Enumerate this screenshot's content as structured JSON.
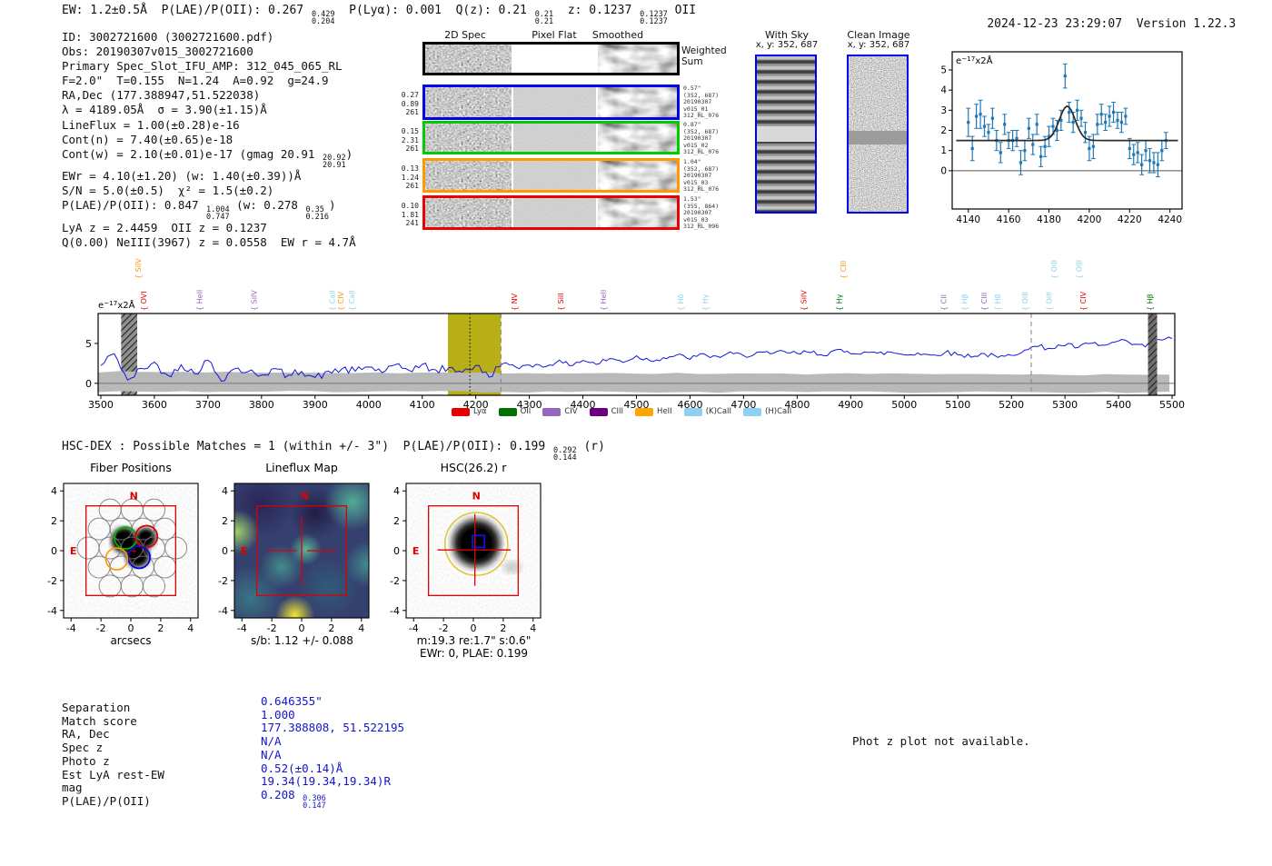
{
  "header": {
    "left_tokens": [
      {
        "t": "EW: 1.2±0.5Å  P(LAE)/P(OII): 0.267 "
      },
      {
        "s": [
          "0.429",
          "0.204"
        ]
      },
      {
        "t": "  P(Lyα): 0.001  Q(z): 0.21 "
      },
      {
        "s": [
          "0.21",
          "0.21"
        ]
      },
      {
        "t": "  z: 0.1237 "
      },
      {
        "s": [
          "0.1237",
          "0.1237"
        ]
      },
      {
        "t": " OII"
      }
    ],
    "timestamp": "2024-12-23 23:29:07",
    "version": "Version 1.22.3"
  },
  "info_lines": [
    [
      {
        "t": "ID: 3002721600 (3002721600.pdf)"
      }
    ],
    [
      {
        "t": "Obs: 20190307v015_3002721600"
      }
    ],
    [
      {
        "t": "Primary Spec_Slot_IFU_AMP: 312_045_065_RL"
      }
    ],
    [
      {
        "t": "F=2.0\"  T=0.155  N=1.24  A=0.92  g=24.9"
      }
    ],
    [
      {
        "t": "RA,Dec (177.388947,51.522038)"
      }
    ],
    [
      {
        "t": "λ = 4189.05Å  σ = 3.90(±1.15)Å"
      }
    ],
    [
      {
        "t": "LineFlux = 1.00(±0.28)e-16"
      }
    ],
    [
      {
        "t": "Cont(n) = 7.40(±0.65)e-18"
      }
    ],
    [
      {
        "t": "Cont(w) = 2.10(±0.01)e-17 (gmag 20.91 "
      },
      {
        "s": [
          "20.92",
          "20.91"
        ]
      },
      {
        "t": ")"
      }
    ],
    [
      {
        "t": "EWr = 4.10(±1.20) (w: 1.40(±0.39))Å"
      }
    ],
    [
      {
        "t": "S/N = 5.0(±0.5)  χ² = 1.5(±0.2)"
      }
    ],
    [
      {
        "t": "P(LAE)/P(OII): 0.847 "
      },
      {
        "s": [
          "1.004",
          "0.747"
        ]
      },
      {
        "t": " (w: 0.278 "
      },
      {
        "s": [
          "0.35",
          "0.216"
        ]
      },
      {
        "t": ")"
      }
    ],
    [
      {
        "t": "LyA z = 2.4459  OII z = 0.1237"
      }
    ],
    [
      {
        "t": "Q(0.00) NeIII(3967) z = 0.0558  EW r = 4.7Å"
      }
    ]
  ],
  "spec2d": {
    "headers": [
      "2D Spec",
      "Pixel Flat",
      "Smoothed"
    ],
    "weighted_sum_label": "Weighted\nSum",
    "rows": [
      {
        "border": "#000000",
        "left": [],
        "right": []
      },
      {
        "border": "#0000ee",
        "left": [
          "0.27",
          "0.89",
          "261"
        ],
        "right": [
          "0.57\"",
          "(352, 687)",
          "20190307",
          "v015_01",
          "312_RL_076"
        ]
      },
      {
        "border": "#00cc00",
        "left": [
          "0.15",
          "2.31",
          "261"
        ],
        "right": [
          "0.87\"",
          "(352, 687)",
          "20190307",
          "v015_02",
          "312_RL_076"
        ]
      },
      {
        "border": "#ff9900",
        "left": [
          "0.13",
          "1.24",
          "261"
        ],
        "right": [
          "1.04\"",
          "(352, 687)",
          "20190307",
          "v015_03",
          "312_RL_076"
        ]
      },
      {
        "border": "#ee0000",
        "left": [
          "0.10",
          "1.81",
          "241"
        ],
        "right": [
          "1.53\"",
          "(355, 864)",
          "20190307",
          "v015_03",
          "312_RL_096"
        ]
      }
    ]
  },
  "cutouts2d": {
    "with_sky": {
      "title": "With Sky",
      "coords": "x, y: 352, 687"
    },
    "clean": {
      "title": "Clean Image",
      "coords": "x, y: 352, 687"
    }
  },
  "hsc_line_tokens": [
    {
      "t": "HSC-DEX : Possible Matches = 1 (within +/- 3\")  P(LAE)/P(OII): 0.199 "
    },
    {
      "s": [
        "0.292",
        "0.144"
      ]
    },
    {
      "t": " (r)"
    }
  ],
  "phot_z_note": "Phot z plot not available.",
  "match_table": {
    "rows": [
      {
        "label": "Separation",
        "value_tokens": [
          {
            "t": "0.646355\""
          }
        ]
      },
      {
        "label": "Match score",
        "value_tokens": [
          {
            "t": "1.000"
          }
        ]
      },
      {
        "label": "RA, Dec",
        "value_tokens": [
          {
            "t": "177.388808, 51.522195"
          }
        ]
      },
      {
        "label": "Spec z",
        "value_tokens": [
          {
            "t": "N/A"
          }
        ]
      },
      {
        "label": "Photo z",
        "value_tokens": [
          {
            "t": "N/A"
          }
        ]
      },
      {
        "label": "Est LyA rest-EW",
        "value_tokens": [
          {
            "t": "0.52(±0.14)Å"
          }
        ]
      },
      {
        "label": "mag",
        "value_tokens": [
          {
            "t": "19.34(19.34,19.34)R"
          }
        ]
      },
      {
        "label": "P(LAE)/P(OII)",
        "value_tokens": [
          {
            "t": "0.208 "
          },
          {
            "s": [
              "0.306",
              "0.147"
            ]
          }
        ]
      }
    ]
  },
  "chart_data": [
    {
      "id": "line_fit_zoom",
      "type": "scatter",
      "inner_label": "e-17x2Å",
      "xlim": [
        4132,
        4246
      ],
      "ylim": [
        -1.9,
        5.9
      ],
      "xticks": [
        4140,
        4160,
        4180,
        4200,
        4220,
        4240
      ],
      "yticks": [
        0,
        1,
        2,
        3,
        4,
        5
      ],
      "x_start": 4140,
      "x_step": 2,
      "y": [
        2.4,
        1.1,
        2.7,
        2.8,
        2.2,
        1.9,
        2.6,
        1.5,
        0.9,
        2.3,
        1.5,
        1.5,
        1.6,
        0.4,
        1.0,
        2.1,
        1.3,
        2.3,
        0.7,
        1.2,
        1.7,
        2.2,
        2.0,
        2.5,
        4.7,
        2.9,
        2.4,
        3.0,
        2.6,
        1.9,
        1.1,
        1.2,
        2.3,
        2.8,
        2.4,
        2.7,
        2.9,
        2.5,
        2.4,
        2.7,
        1.1,
        0.8,
        0.9,
        0.3,
        1.0,
        0.5,
        0.4,
        0.3,
        1.0,
        1.5
      ],
      "yerr": [
        0.7,
        0.6,
        0.6,
        0.7,
        0.5,
        0.4,
        0.5,
        0.5,
        0.5,
        0.5,
        0.4,
        0.5,
        0.4,
        0.6,
        0.5,
        0.5,
        0.5,
        0.5,
        0.5,
        0.5,
        0.5,
        0.4,
        0.5,
        0.5,
        0.6,
        0.5,
        0.5,
        0.5,
        0.4,
        0.5,
        0.6,
        0.6,
        0.5,
        0.5,
        0.4,
        0.5,
        0.5,
        0.4,
        0.5,
        0.4,
        0.5,
        0.5,
        0.5,
        0.5,
        0.5,
        0.6,
        0.5,
        0.6,
        0.5,
        0.4
      ],
      "fit": {
        "shape": "gaussian",
        "center": 4189.05,
        "sigma": 3.9,
        "peak": 3.2,
        "continuum": 1.5
      },
      "colors": {
        "points": "#1f77b4",
        "fit": "#2b2b2b",
        "zero_line": "#555555"
      }
    },
    {
      "id": "full_spectrum",
      "type": "line",
      "ylabel": "e-17x2Å",
      "x_start": 3500,
      "x_step": 25,
      "values": [
        2.2,
        3.8,
        0.3,
        1.8,
        2.6,
        0.9,
        2.4,
        1.2,
        2.9,
        0.4,
        1.9,
        1.4,
        1.1,
        1.8,
        0.9,
        1.6,
        0.7,
        1.4,
        1.8,
        1.5,
        2.1,
        1.4,
        2.2,
        1.7,
        2.3,
        1.6,
        1.9,
        1.5,
        2.2,
        0.8,
        2.6,
        1.9,
        2.4,
        2.1,
        2.7,
        2.3,
        2.9,
        2.4,
        3.1,
        2.7,
        3.4,
        2.9,
        3.2,
        3.5,
        3.1,
        3.6,
        3.3,
        3.8,
        3.4,
        3.9,
        3.6,
        4.0,
        3.7,
        3.9,
        3.6,
        4.1,
        3.8,
        4.0,
        3.7,
        3.9,
        3.6,
        3.8,
        3.5,
        3.9,
        3.6,
        3.4,
        3.7,
        3.2,
        3.5,
        4.3,
        4.6,
        4.4,
        4.8,
        4.5,
        5.0,
        4.7,
        5.3,
        4.9,
        4.6,
        5.5,
        5.6
      ],
      "xlim": [
        3495,
        5505
      ],
      "ylim": [
        -1.5,
        8.75
      ],
      "xticks": [
        3500,
        3600,
        3700,
        3800,
        3900,
        4000,
        4100,
        4200,
        4300,
        4400,
        4500,
        4600,
        4700,
        4800,
        4900,
        5000,
        5100,
        5200,
        5300,
        5400,
        5500
      ],
      "yticks": [
        0,
        5
      ],
      "colors": {
        "line": "#1414dd",
        "noise_band": "#b9b9b9",
        "highlight": "#b3ab08",
        "sky_band": "#8f8f8f",
        "dashed": "#888888"
      },
      "annotations": {
        "emission_center": 4189.05,
        "highlight_region": [
          4148,
          4247
        ],
        "sky_absorption_band": [
          3538,
          3568
        ],
        "dashed_lines": [
          4247,
          5237
        ],
        "hatch_band": [
          5455,
          5472
        ]
      },
      "line_labels": [
        {
          "text": "SiIV",
          "color": "#ff9900",
          "wl": 3570,
          "tier": 1
        },
        {
          "text": "OVI",
          "color": "#e50000",
          "wl": 3580,
          "tier": 0
        },
        {
          "text": "HeII",
          "color": "#9467bd",
          "wl": 3684,
          "tier": 0
        },
        {
          "text": "SiIV",
          "color": "#9467bd",
          "wl": 3786,
          "tier": 0
        },
        {
          "text": "CaII",
          "color": "#8fd0f0",
          "wl": 3932,
          "tier": 0
        },
        {
          "text": "CIV",
          "color": "#ff9900",
          "wl": 3948,
          "tier": 0
        },
        {
          "text": "CaII",
          "color": "#8fd0f0",
          "wl": 3968,
          "tier": 0
        },
        {
          "text": "NV",
          "color": "#e50000",
          "wl": 4272,
          "tier": 0
        },
        {
          "text": "SiII",
          "color": "#e50000",
          "wl": 4358,
          "tier": 0
        },
        {
          "text": "HeII",
          "color": "#9467bd",
          "wl": 4438,
          "tier": 0
        },
        {
          "text": "Hδ",
          "color": "#8fd0f0",
          "wl": 4582,
          "tier": 0
        },
        {
          "text": "Hγ",
          "color": "#8fd0f0",
          "wl": 4628,
          "tier": 0
        },
        {
          "text": "SiIV",
          "color": "#e50000",
          "wl": 4812,
          "tier": 0
        },
        {
          "text": "CIII",
          "color": "#ff9900",
          "wl": 4886,
          "tier": 1
        },
        {
          "text": "Hγ",
          "color": "#007000",
          "wl": 4878,
          "tier": 0
        },
        {
          "text": "CII",
          "color": "#9467bd",
          "wl": 5073,
          "tier": 0
        },
        {
          "text": "Hβ",
          "color": "#8fd0f0",
          "wl": 5112,
          "tier": 0
        },
        {
          "text": "CIII",
          "color": "#9467bd",
          "wl": 5149,
          "tier": 0
        },
        {
          "text": "H8",
          "color": "#8fd0f0",
          "wl": 5174,
          "tier": 0
        },
        {
          "text": "OIII",
          "color": "#8fd0f0",
          "wl": 5225,
          "tier": 0
        },
        {
          "text": "OIII",
          "color": "#8fd0f0",
          "wl": 5270,
          "tier": 0
        },
        {
          "text": "OIII",
          "color": "#8fd0f0",
          "wl": 5279,
          "tier": 1
        },
        {
          "text": "OIII",
          "color": "#8fd0f0",
          "wl": 5326,
          "tier": 1
        },
        {
          "text": "CIV",
          "color": "#e50000",
          "wl": 5334,
          "tier": 0
        },
        {
          "text": "Hβ",
          "color": "#007000",
          "wl": 5458,
          "tier": 0
        }
      ],
      "legend": [
        {
          "label": "Lyα",
          "color": "#e50000"
        },
        {
          "label": "OII",
          "color": "#007000"
        },
        {
          "label": "CIV",
          "color": "#9467bd"
        },
        {
          "label": "CIII",
          "color": "#6a0080"
        },
        {
          "label": "HeII",
          "color": "#ffa500"
        },
        {
          "label": "(K)CaII",
          "color": "#8fd0f0"
        },
        {
          "label": "(H)CaII",
          "color": "#8fd0f0"
        }
      ]
    },
    {
      "id": "fiber_positions",
      "type": "scatter",
      "title": "Fiber Positions",
      "xlabel": "arcsecs",
      "ticks": [
        -4,
        -2,
        0,
        2,
        4
      ],
      "lim": [
        -4.5,
        4.5
      ],
      "fiber_radius_arcsec": 0.73,
      "grid_center": [
        0.08,
        0.18
      ],
      "grid_spacing": 1.47,
      "highlight_fibers": [
        {
          "x": -0.35,
          "y": 0.85,
          "color": "#00b300"
        },
        {
          "x": 1.05,
          "y": 0.95,
          "color": "#dd0000"
        },
        {
          "x": 0.55,
          "y": -0.45,
          "color": "#0000dd"
        },
        {
          "x": -0.95,
          "y": -0.55,
          "color": "#ff9900"
        }
      ],
      "compass": {
        "n": "N",
        "e": "E",
        "color": "#dd0000"
      },
      "box_half_size": 3
    },
    {
      "id": "lineflux_map",
      "type": "heatmap",
      "title": "Lineflux Map",
      "xlabel": "s/b: 1.12 +/- 0.088",
      "ticks": [
        -4,
        -2,
        0,
        2,
        4
      ],
      "lim": [
        -4.5,
        4.5
      ],
      "colormap": "viridis",
      "colormap_hex": [
        "#440154",
        "#3b528b",
        "#21918c",
        "#5ec962",
        "#fde725"
      ],
      "compass": {
        "n": "N",
        "e": "E",
        "color": "#dd0000"
      },
      "box_half_size": 3
    },
    {
      "id": "hsc_cutout",
      "type": "image",
      "title": "HSC(26.2) r",
      "xlabel_line1": "m:19.3 re:1.7\" s:0.6\"",
      "xlabel_line2": "EWr: 0, PLAE: 0.199",
      "ticks": [
        -4,
        -2,
        0,
        2,
        4
      ],
      "lim": [
        -4.5,
        4.5
      ],
      "aperture_circle": {
        "x": 0.2,
        "y": 0.45,
        "r": 2.1,
        "color": "#e2c53e"
      },
      "catalog_box": {
        "x": 0.35,
        "y": 0.62,
        "size": 0.8,
        "color": "#1212dd"
      },
      "compass": {
        "n": "N",
        "e": "E",
        "color": "#dd0000"
      },
      "box_half_size": 3
    }
  ]
}
